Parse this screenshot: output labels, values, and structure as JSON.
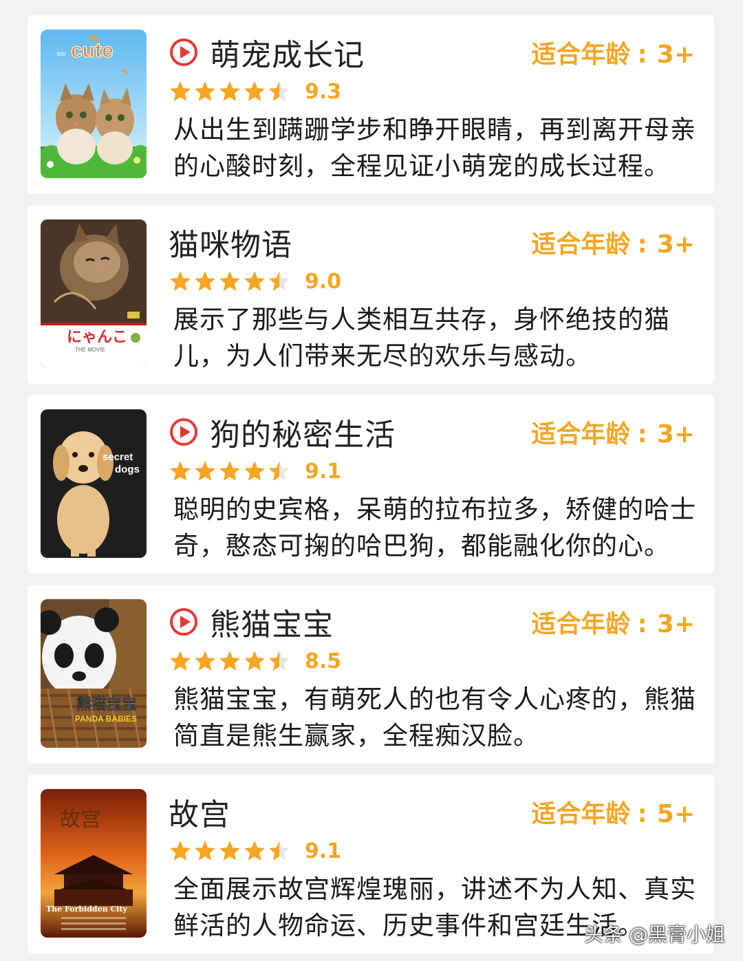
{
  "colors": {
    "accent": "#f5a623",
    "play": "#e53935",
    "text": "#222222"
  },
  "age_label": "适合年龄",
  "age_sep": ":",
  "items": [
    {
      "title": "萌宠成长记",
      "has_play_icon": true,
      "rating_stars": 4.5,
      "score": "9.3",
      "age": "3+",
      "desc": "从出生到蹒跚学步和睁开眼睛，再到离开母亲的心酸时刻，全程见证小萌宠的成长过程。",
      "poster": {
        "title_text": "too cute",
        "kind": "kittens"
      }
    },
    {
      "title": "猫咪物语",
      "has_play_icon": false,
      "rating_stars": 4.5,
      "score": "9.0",
      "age": "3+",
      "desc": "展示了那些与人类相互共存，身怀绝技的猫儿，为人们带来无尽的欢乐与感动。",
      "poster": {
        "title_text": "にゃんこ",
        "subtitle_text": "THE MOVIE",
        "kind": "cat"
      }
    },
    {
      "title": "狗的秘密生活",
      "has_play_icon": true,
      "rating_stars": 4.5,
      "score": "9.1",
      "age": "3+",
      "desc": "聪明的史宾格，呆萌的拉布拉多，矫健的哈士奇，憨态可掬的哈巴狗，都能融化你的心。",
      "poster": {
        "title_text": "secret",
        "subtitle_text": "dogs",
        "kind": "dog"
      }
    },
    {
      "title": "熊猫宝宝",
      "has_play_icon": true,
      "rating_stars": 4.5,
      "score": "8.5",
      "age": "3+",
      "desc": "熊猫宝宝，有萌死人的也有令人心疼的，熊猫简直是熊生赢家，全程痴汉脸。",
      "poster": {
        "title_text": "熊猫宝宝",
        "subtitle_text": "PANDA BABIES",
        "kind": "panda"
      }
    },
    {
      "title": "故宫",
      "has_play_icon": false,
      "rating_stars": 4.5,
      "score": "9.1",
      "age": "5+",
      "desc": "全面展示故宫辉煌瑰丽，讲述不为人知、真实鲜活的人物命运、历史事件和宫廷生活。",
      "poster": {
        "title_text": "故宫",
        "subtitle_text": "The Forbidden City",
        "kind": "palace"
      }
    }
  ],
  "watermark": "头条 @黑膏小姐"
}
